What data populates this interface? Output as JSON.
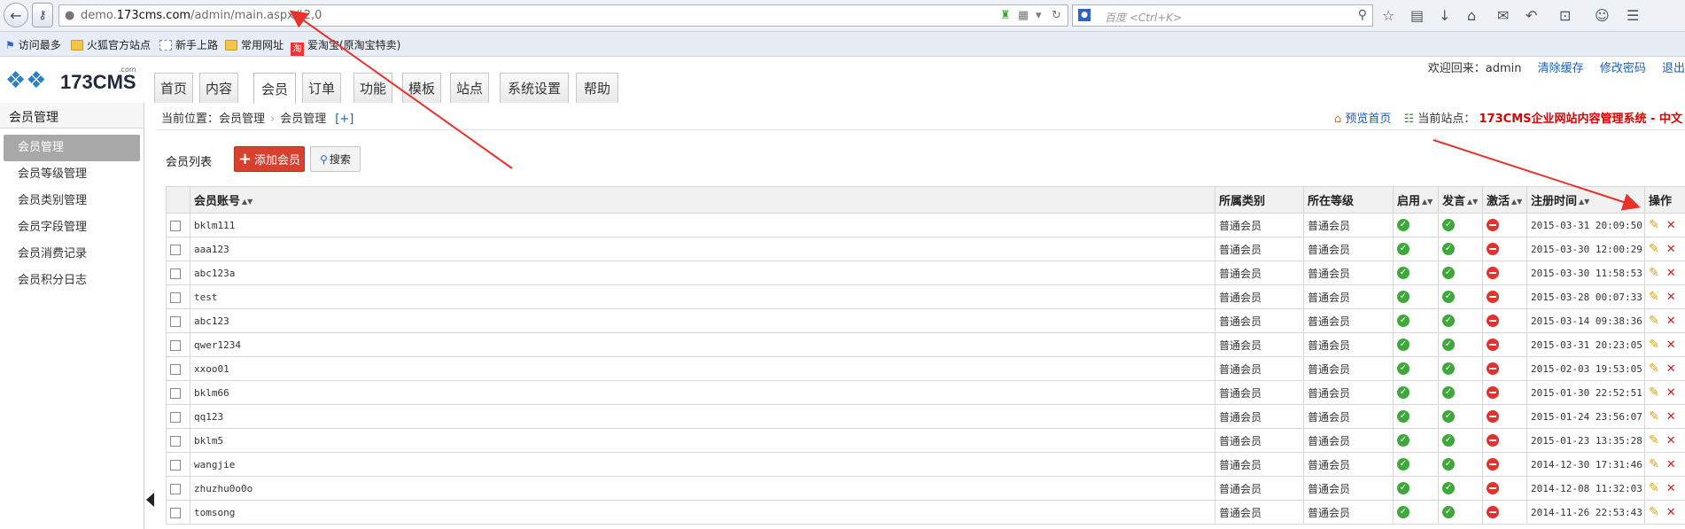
{
  "browser": {
    "url_prefix": "demo.",
    "url_domain": "173cms.com",
    "url_path": "/admin/main.aspx#2,0",
    "search_placeholder": "百度 <Ctrl+K>",
    "bookmarks": [
      "访问最多",
      "火狐官方站点",
      "新手上路",
      "常用网址",
      "爱淘宝(原淘宝特卖)"
    ]
  },
  "header": {
    "logo_text": "173CMS",
    "logo_com": ".com",
    "tabs": [
      "首页",
      "内容",
      "会员",
      "订单",
      "功能",
      "模板",
      "站点",
      "系统设置",
      "帮助"
    ],
    "active_tab": "会员",
    "welcome_prefix": "欢迎回来：",
    "username": "admin",
    "clear_cache": "清除缓存",
    "change_password": "修改密码",
    "logout": "退出"
  },
  "sidebar": {
    "title": "会员管理",
    "items": [
      "会员管理",
      "会员等级管理",
      "会员类别管理",
      "会员字段管理",
      "会员消费记录",
      "会员积分日志"
    ]
  },
  "breadcrumb": {
    "prefix": "当前位置：",
    "level1": "会员管理",
    "level2": "会员管理",
    "expand": "[+]",
    "preview": "预览首页",
    "current_site_label": "当前站点：",
    "current_site": "173CMS企业网站内容管理系统 - 中文"
  },
  "toolbar": {
    "list_title": "会员列表",
    "add_button": "添加会员",
    "search_button": "搜索"
  },
  "table": {
    "columns": [
      "会员账号",
      "所属类别",
      "所在等级",
      "启用",
      "发言",
      "激活",
      "注册时间",
      "操作"
    ],
    "rows": [
      {
        "account": "bklm111",
        "category": "普通会员",
        "level": "普通会员",
        "enabled": true,
        "post": true,
        "activated": false,
        "registered": "2015-03-31 20:09:50"
      },
      {
        "account": "aaa123",
        "category": "普通会员",
        "level": "普通会员",
        "enabled": true,
        "post": true,
        "activated": false,
        "registered": "2015-03-30 12:00:29"
      },
      {
        "account": "abc123a",
        "category": "普通会员",
        "level": "普通会员",
        "enabled": true,
        "post": true,
        "activated": false,
        "registered": "2015-03-30 11:58:53"
      },
      {
        "account": "test",
        "category": "普通会员",
        "level": "普通会员",
        "enabled": true,
        "post": true,
        "activated": false,
        "registered": "2015-03-28 00:07:33"
      },
      {
        "account": "abc123",
        "category": "普通会员",
        "level": "普通会员",
        "enabled": true,
        "post": true,
        "activated": false,
        "registered": "2015-03-14 09:38:36"
      },
      {
        "account": "qwer1234",
        "category": "普通会员",
        "level": "普通会员",
        "enabled": true,
        "post": true,
        "activated": false,
        "registered": "2015-03-31 20:23:05"
      },
      {
        "account": "xxoo01",
        "category": "普通会员",
        "level": "普通会员",
        "enabled": true,
        "post": true,
        "activated": false,
        "registered": "2015-02-03 19:53:05"
      },
      {
        "account": "bklm66",
        "category": "普通会员",
        "level": "普通会员",
        "enabled": true,
        "post": true,
        "activated": false,
        "registered": "2015-01-30 22:52:51"
      },
      {
        "account": "qq123",
        "category": "普通会员",
        "level": "普通会员",
        "enabled": true,
        "post": true,
        "activated": false,
        "registered": "2015-01-24 23:56:07"
      },
      {
        "account": "bklm5",
        "category": "普通会员",
        "level": "普通会员",
        "enabled": true,
        "post": true,
        "activated": false,
        "registered": "2015-01-23 13:35:28"
      },
      {
        "account": "wangjie",
        "category": "普通会员",
        "level": "普通会员",
        "enabled": true,
        "post": true,
        "activated": false,
        "registered": "2014-12-30 17:31:46"
      },
      {
        "account": "zhuzhu0o0o",
        "category": "普通会员",
        "level": "普通会员",
        "enabled": true,
        "post": true,
        "activated": false,
        "registered": "2014-12-08 11:32:03"
      },
      {
        "account": "tomsong",
        "category": "普通会员",
        "level": "普通会员",
        "enabled": true,
        "post": true,
        "activated": false,
        "registered": "2014-11-26 22:53:43"
      }
    ]
  },
  "colors": {
    "accent_red": "#d9412f",
    "annotation_arrow": "#e8322a",
    "status_ok": "#3ea83a",
    "status_off": "#e0322f"
  }
}
